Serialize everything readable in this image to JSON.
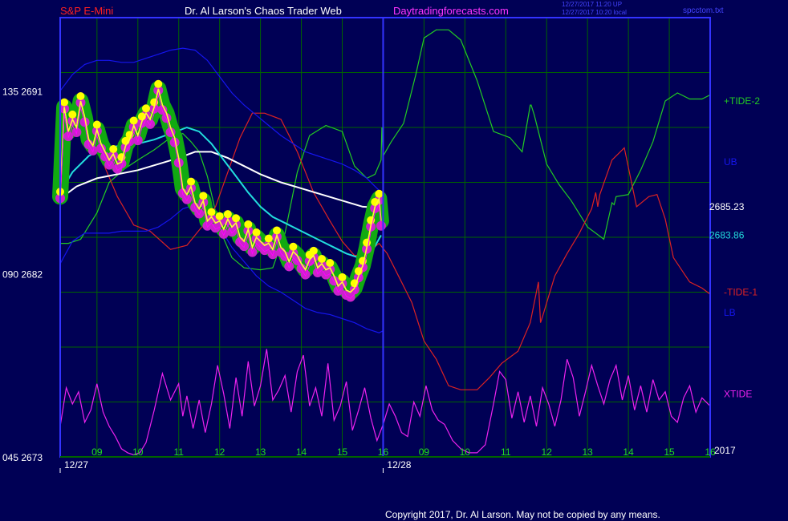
{
  "header": {
    "symbol": "S&P E-Mini",
    "site_name": "Dr. Al Larson's Chaos Trader Web",
    "url": "Daytradingforecasts.com",
    "timestamp_up": "12/27/2017 11:20 UP",
    "timestamp_local": "12/27/2017 10:20 local",
    "file_name": "spcctom.txt"
  },
  "colors": {
    "background": "#000055",
    "grid": "#006400",
    "frame": "#3333ff",
    "divider": "#3333ff",
    "symbol": "#ff2020",
    "site_name": "#ffffff",
    "url": "#ff33ff",
    "timestamp": "#4444ff",
    "axis_text": "#ffffff",
    "tick_text": "#22dd22",
    "date_text": "#ffffff",
    "copyright": "#ffffff",
    "tide_plus": "#22cc22",
    "tide_minus": "#dd2222",
    "xtide": "#ee22ee",
    "bands": "#1515ee",
    "white_avg": "#ffffff",
    "cyan_avg": "#22dddd",
    "price_line": "#ffff33",
    "price_magenta": "#ff00ff",
    "halo_green": "#11aa11",
    "dot_yellow": "#ffff00",
    "dot_magenta": "#cc22cc"
  },
  "chart_data": {
    "type": "line",
    "y_axis_labels": [
      {
        "label": "135  2691",
        "value": 2691
      },
      {
        "label": "090  2682",
        "value": 2682
      },
      {
        "label": "045  2673",
        "value": 2673
      }
    ],
    "ylim": [
      2673,
      2694.6
    ],
    "x_tick_labels": [
      "09",
      "10",
      "11",
      "12",
      "13",
      "14",
      "15",
      "16",
      "09",
      "10",
      "11",
      "12",
      "13",
      "14",
      "15",
      "16"
    ],
    "x_dates": [
      {
        "label": "12/27",
        "index": 0
      },
      {
        "label": "12/28",
        "index": 8
      }
    ],
    "year_label": "2017",
    "xlim": [
      8.1,
      24.0
    ],
    "now_x": 16.0,
    "right_labels": [
      {
        "label": "+TIDE-2",
        "value": 2690.5,
        "color_key": "tide_plus"
      },
      {
        "label": "UB",
        "value": 2687.5,
        "color_key": "bands"
      },
      {
        "label": "2685.23",
        "value": 2685.3,
        "color_key": "axis_text"
      },
      {
        "label": "2683.86",
        "value": 2683.9,
        "color_key": "cyan_avg"
      },
      {
        "label": "-TIDE-1",
        "value": 2681.1,
        "color_key": "tide_minus"
      },
      {
        "label": "LB",
        "value": 2680.1,
        "color_key": "bands"
      },
      {
        "label": "XTIDE",
        "value": 2676.1,
        "color_key": "xtide"
      }
    ],
    "series": [
      {
        "name": "+TIDE-2",
        "color_key": "tide_plus",
        "x": [
          8.1,
          8.3,
          8.6,
          9.0,
          9.3,
          9.7,
          10.0,
          10.4,
          10.8,
          11.1,
          11.3,
          11.5,
          11.7,
          12.0,
          12.3,
          12.6,
          13.0,
          13.3,
          13.6,
          13.9,
          14.2,
          14.6,
          15.0,
          15.3,
          15.6,
          15.8,
          15.95,
          15.97,
          16.0,
          16.2,
          16.5,
          16.8,
          17.0,
          17.3,
          17.6,
          17.9,
          18.3,
          18.7,
          19.1,
          19.4,
          19.6,
          19.62,
          19.7,
          20.0,
          20.3,
          20.6,
          21.0,
          21.2,
          21.4,
          21.6,
          21.65,
          21.7,
          22.0,
          22.3,
          22.6,
          22.9,
          23.2,
          23.5,
          23.8,
          24.0
        ],
        "y": [
          2683.5,
          2683.5,
          2683.7,
          2685.0,
          2686.5,
          2687.2,
          2687.6,
          2688.1,
          2688.7,
          2688.9,
          2688.5,
          2688.0,
          2686.8,
          2684.2,
          2682.8,
          2682.3,
          2682.2,
          2682.3,
          2684.0,
          2687.0,
          2688.8,
          2689.3,
          2689.0,
          2687.3,
          2686.7,
          2686.9,
          2687.6,
          2689.2,
          2687.8,
          2688.5,
          2689.4,
          2691.8,
          2693.6,
          2694.0,
          2694.0,
          2693.5,
          2691.5,
          2689.0,
          2688.7,
          2688.0,
          2690.3,
          2690.3,
          2689.8,
          2687.4,
          2686.4,
          2685.6,
          2684.3,
          2684.0,
          2683.7,
          2685.5,
          2685.4,
          2685.8,
          2685.9,
          2687.1,
          2688.5,
          2690.5,
          2690.9,
          2690.6,
          2690.6,
          2690.8
        ]
      },
      {
        "name": "-TIDE-1",
        "color_key": "tide_minus",
        "x": [
          8.1,
          8.4,
          8.8,
          9.1,
          9.5,
          9.9,
          10.3,
          10.8,
          11.2,
          11.6,
          11.9,
          12.2,
          12.5,
          12.8,
          13.1,
          13.5,
          13.9,
          14.3,
          14.7,
          15.0,
          15.3,
          15.6,
          15.9,
          16.1,
          16.4,
          16.7,
          17.0,
          17.3,
          17.6,
          17.9,
          18.3,
          18.6,
          18.9,
          19.3,
          19.6,
          19.8,
          19.85,
          19.9,
          20.2,
          20.5,
          20.8,
          21.1,
          21.2,
          21.25,
          21.3,
          21.6,
          21.9,
          22.2,
          22.5,
          22.7,
          22.9,
          23.1,
          23.5,
          23.8,
          24.0
        ],
        "y": [
          2690.5,
          2690.2,
          2689.5,
          2687.7,
          2685.8,
          2684.4,
          2684.1,
          2683.2,
          2683.4,
          2684.4,
          2685.3,
          2687.0,
          2688.7,
          2689.9,
          2689.9,
          2689.6,
          2688.0,
          2686.0,
          2684.6,
          2683.6,
          2682.9,
          2683.0,
          2683.5,
          2683.0,
          2681.8,
          2680.6,
          2678.7,
          2677.8,
          2676.5,
          2676.3,
          2676.3,
          2676.9,
          2677.6,
          2678.2,
          2679.6,
          2681.6,
          2679.6,
          2679.9,
          2681.9,
          2683.0,
          2684.0,
          2685.2,
          2686.0,
          2685.3,
          2685.9,
          2687.6,
          2688.2,
          2685.3,
          2685.8,
          2685.9,
          2684.7,
          2682.8,
          2681.6,
          2681.3,
          2681.0
        ]
      },
      {
        "name": "XTIDE",
        "color_key": "xtide",
        "x": [
          8.1,
          8.25,
          8.4,
          8.55,
          8.7,
          8.85,
          9.0,
          9.15,
          9.3,
          9.45,
          9.6,
          9.75,
          9.9,
          10.05,
          10.2,
          10.4,
          10.6,
          10.8,
          11.0,
          11.1,
          11.2,
          11.35,
          11.5,
          11.65,
          11.8,
          11.95,
          12.1,
          12.25,
          12.4,
          12.55,
          12.7,
          12.85,
          13.0,
          13.15,
          13.3,
          13.45,
          13.6,
          13.75,
          13.9,
          14.05,
          14.2,
          14.35,
          14.5,
          14.65,
          14.8,
          14.95,
          15.1,
          15.25,
          15.4,
          15.55,
          15.7,
          15.85,
          16.0,
          16.15,
          16.3,
          16.45,
          16.6,
          16.75,
          16.9,
          17.05,
          17.2,
          17.35,
          17.5,
          17.7,
          17.9,
          18.1,
          18.3,
          18.5,
          18.7,
          18.85,
          19.0,
          19.15,
          19.3,
          19.45,
          19.6,
          19.75,
          19.9,
          20.05,
          20.2,
          20.35,
          20.5,
          20.65,
          20.8,
          20.95,
          21.1,
          21.25,
          21.4,
          21.55,
          21.7,
          21.85,
          22.0,
          22.15,
          22.3,
          22.45,
          22.6,
          22.75,
          22.9,
          23.05,
          23.2,
          23.35,
          23.5,
          23.65,
          23.8,
          24.0
        ],
        "y": [
          2674.5,
          2676.4,
          2675.6,
          2676.2,
          2674.7,
          2675.3,
          2676.6,
          2675.2,
          2674.5,
          2674.0,
          2673.4,
          2673.2,
          2673.1,
          2673.2,
          2673.7,
          2675.3,
          2677.1,
          2675.8,
          2676.6,
          2675.0,
          2676.0,
          2674.4,
          2675.8,
          2674.2,
          2675.6,
          2677.5,
          2676.1,
          2674.4,
          2676.9,
          2675.0,
          2677.7,
          2675.5,
          2676.5,
          2678.3,
          2675.8,
          2676.3,
          2677.0,
          2675.2,
          2677.2,
          2678.0,
          2675.5,
          2676.4,
          2675.0,
          2677.6,
          2674.8,
          2675.5,
          2676.7,
          2674.3,
          2675.3,
          2676.4,
          2674.9,
          2673.8,
          2674.6,
          2675.6,
          2675.0,
          2674.2,
          2674.0,
          2675.7,
          2675.0,
          2676.5,
          2675.3,
          2674.8,
          2674.6,
          2673.8,
          2673.4,
          2673.2,
          2673.2,
          2673.6,
          2675.6,
          2677.2,
          2676.8,
          2674.9,
          2676.2,
          2674.7,
          2676.0,
          2674.5,
          2676.4,
          2675.6,
          2674.5,
          2675.8,
          2677.8,
          2676.9,
          2675.0,
          2676.2,
          2677.5,
          2676.5,
          2675.6,
          2676.8,
          2677.5,
          2675.8,
          2677.0,
          2675.3,
          2676.5,
          2675.2,
          2676.8,
          2675.8,
          2676.2,
          2675.0,
          2674.7,
          2675.9,
          2676.5,
          2675.2,
          2675.9,
          2675.5
        ]
      },
      {
        "name": "UB",
        "color_key": "bands",
        "x": [
          8.1,
          8.4,
          8.7,
          9.0,
          9.3,
          9.6,
          9.9,
          10.2,
          10.5,
          10.8,
          11.1,
          11.4,
          11.7,
          12.0,
          12.3,
          12.6,
          12.9,
          13.2,
          13.5,
          13.8,
          14.1,
          14.4,
          14.7,
          15.0,
          15.3,
          15.6,
          15.9,
          16.0
        ],
        "y": [
          2691.0,
          2691.8,
          2692.3,
          2692.5,
          2692.5,
          2692.4,
          2692.4,
          2692.6,
          2692.8,
          2693.0,
          2693.1,
          2693.0,
          2692.5,
          2691.7,
          2690.9,
          2690.3,
          2689.8,
          2689.3,
          2688.8,
          2688.4,
          2688.0,
          2687.8,
          2687.6,
          2687.4,
          2687.1,
          2686.7,
          2686.1,
          2685.9
        ]
      },
      {
        "name": "LB",
        "color_key": "bands",
        "x": [
          8.1,
          8.4,
          8.7,
          9.0,
          9.3,
          9.6,
          9.9,
          10.2,
          10.5,
          10.8,
          11.1,
          11.4,
          11.7,
          12.0,
          12.3,
          12.6,
          12.9,
          13.2,
          13.5,
          13.8,
          14.1,
          14.4,
          14.7,
          15.0,
          15.3,
          15.6,
          15.9,
          16.0
        ],
        "y": [
          2682.5,
          2683.6,
          2684.0,
          2684.0,
          2684.0,
          2684.1,
          2684.1,
          2684.1,
          2684.3,
          2684.7,
          2685.2,
          2685.4,
          2685.0,
          2684.3,
          2683.3,
          2682.6,
          2681.9,
          2681.4,
          2681.1,
          2680.7,
          2680.3,
          2680.1,
          2680.0,
          2679.8,
          2679.6,
          2679.3,
          2679.1,
          2679.2
        ]
      },
      {
        "name": "",
        "color_key": "white_avg",
        "x": [
          8.1,
          8.5,
          9.0,
          9.5,
          10.0,
          10.5,
          11.0,
          11.4,
          11.8,
          12.2,
          12.6,
          13.0,
          13.5,
          14.0,
          14.5,
          15.0,
          15.5,
          15.95
        ],
        "y": [
          2685.7,
          2686.3,
          2686.7,
          2686.9,
          2687.1,
          2687.4,
          2687.7,
          2688.0,
          2688.0,
          2687.7,
          2687.3,
          2686.9,
          2686.5,
          2686.2,
          2685.9,
          2685.6,
          2685.3,
          2685.25
        ]
      },
      {
        "name": "",
        "color_key": "cyan_avg",
        "x": [
          8.1,
          8.4,
          8.8,
          9.2,
          9.6,
          10.0,
          10.4,
          10.8,
          11.2,
          11.5,
          11.8,
          12.1,
          12.4,
          12.7,
          13.0,
          13.3,
          13.6,
          13.9,
          14.2,
          14.5,
          14.8,
          15.1,
          15.4,
          15.7,
          15.95
        ],
        "y": [
          2686.0,
          2687.0,
          2687.8,
          2688.2,
          2688.3,
          2688.4,
          2688.6,
          2688.9,
          2689.2,
          2689.0,
          2688.4,
          2687.6,
          2686.8,
          2686.0,
          2685.3,
          2684.8,
          2684.5,
          2684.2,
          2683.9,
          2683.6,
          2683.3,
          2683.0,
          2682.8,
          2683.0,
          2683.9
        ]
      },
      {
        "name": "",
        "color_key": "price_line",
        "x": [
          8.1,
          8.2,
          8.3,
          8.4,
          8.5,
          8.6,
          8.7,
          8.8,
          8.9,
          9.0,
          9.1,
          9.2,
          9.3,
          9.4,
          9.5,
          9.6,
          9.7,
          9.8,
          9.9,
          10.0,
          10.1,
          10.2,
          10.3,
          10.4,
          10.5,
          10.6,
          10.7,
          10.8,
          10.9,
          11.0,
          11.1,
          11.2,
          11.3,
          11.4,
          11.5,
          11.6,
          11.7,
          11.8,
          11.9,
          12.0,
          12.1,
          12.2,
          12.3,
          12.4,
          12.5,
          12.6,
          12.7,
          12.8,
          12.9,
          13.0,
          13.1,
          13.2,
          13.3,
          13.4,
          13.5,
          13.6,
          13.7,
          13.8,
          13.9,
          14.0,
          14.1,
          14.2,
          14.3,
          14.4,
          14.5,
          14.6,
          14.7,
          14.8,
          14.9,
          15.0,
          15.1,
          15.2,
          15.3,
          15.4,
          15.5,
          15.6,
          15.7,
          15.8,
          15.9,
          15.95
        ],
        "y": [
          2685.8,
          2690.2,
          2689.0,
          2689.6,
          2689.2,
          2690.5,
          2689.7,
          2688.6,
          2688.3,
          2689.1,
          2688.4,
          2688.0,
          2687.6,
          2687.9,
          2687.4,
          2687.5,
          2688.3,
          2688.6,
          2689.3,
          2688.8,
          2689.5,
          2689.9,
          2689.6,
          2690.2,
          2691.1,
          2690.3,
          2689.9,
          2689.2,
          2688.7,
          2687.7,
          2686.2,
          2685.9,
          2686.3,
          2685.5,
          2685.2,
          2685.6,
          2684.6,
          2684.8,
          2684.5,
          2684.6,
          2684.2,
          2684.7,
          2684.3,
          2684.5,
          2683.8,
          2683.6,
          2684.2,
          2683.3,
          2683.8,
          2683.6,
          2683.4,
          2683.5,
          2683.2,
          2683.9,
          2683.3,
          2683.1,
          2682.6,
          2683.1,
          2682.9,
          2682.5,
          2682.2,
          2682.7,
          2682.9,
          2682.3,
          2682.5,
          2682.2,
          2682.3,
          2681.9,
          2681.4,
          2681.6,
          2681.2,
          2681.1,
          2681.3,
          2681.9,
          2682.4,
          2683.3,
          2684.4,
          2685.3,
          2685.7,
          2684.6
        ]
      }
    ]
  },
  "copyright": "Copyright 2017, Dr. Al Larson. May not be copied by any means."
}
